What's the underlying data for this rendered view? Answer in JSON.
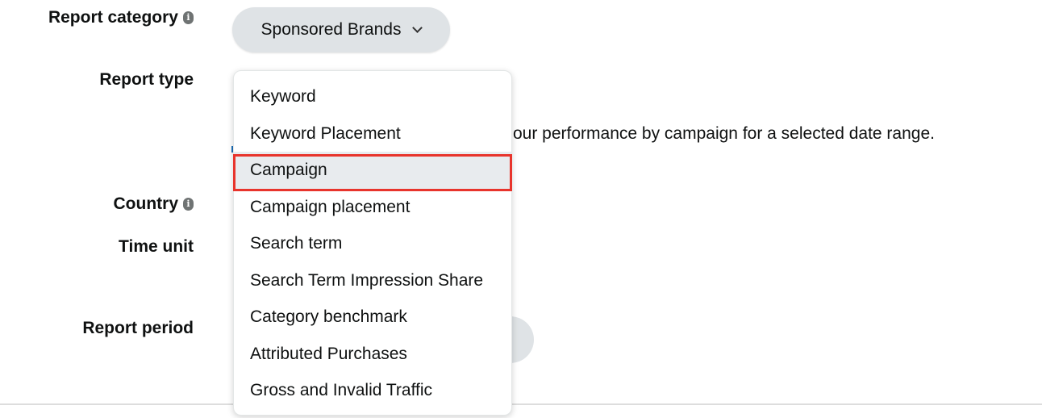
{
  "form": {
    "report_category": {
      "label": "Report category",
      "value": "Sponsored Brands"
    },
    "report_type": {
      "label": "Report type",
      "description": "our performance by campaign for a selected date range."
    },
    "country": {
      "label": "Country"
    },
    "time_unit": {
      "label": "Time unit"
    },
    "report_period": {
      "label": "Report period"
    }
  },
  "dropdown": {
    "items": [
      {
        "label": "Keyword"
      },
      {
        "label": "Keyword Placement"
      },
      {
        "label": "Campaign",
        "selected": true
      },
      {
        "label": "Campaign placement"
      },
      {
        "label": "Search term"
      },
      {
        "label": "Search Term Impression Share"
      },
      {
        "label": "Category benchmark"
      },
      {
        "label": "Attributed Purchases"
      },
      {
        "label": "Gross and Invalid Traffic"
      }
    ]
  },
  "icons": {
    "info": "info-icon",
    "dropdown": "chevron-down-icon"
  },
  "colors": {
    "highlight": "#e8342c",
    "button_bg": "#dfe3e6",
    "selected_bg": "#e8ebee"
  }
}
